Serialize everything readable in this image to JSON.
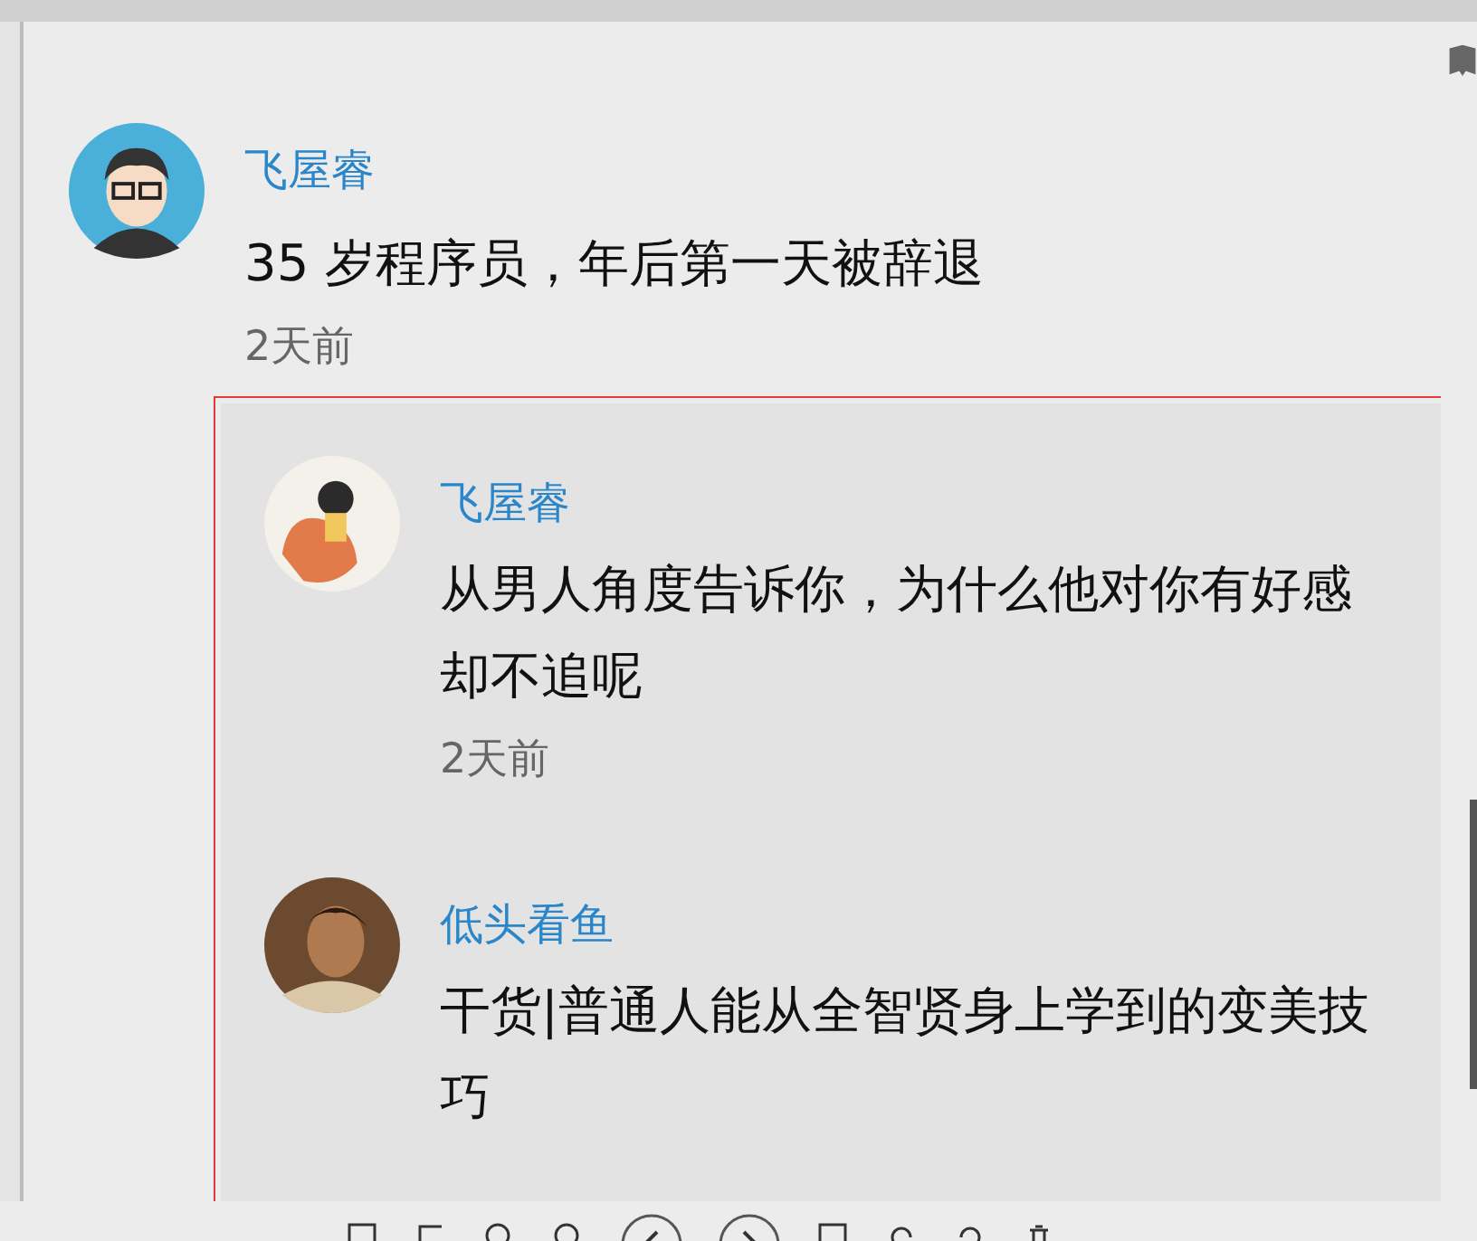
{
  "comment": {
    "author": "飞屋睿",
    "text": "35 岁程序员，年后第一天被辞退",
    "time": "2天前",
    "kind": "glasses"
  },
  "replies": [
    {
      "author": "飞屋睿",
      "text": "从男人角度告诉你，为什么他对你有好感却不追呢",
      "time": "2天前",
      "kind": "drawing"
    },
    {
      "author": "低头看鱼",
      "text": "干货|普通人能从全智贤身上学到的变美技巧",
      "kind": "photo"
    }
  ]
}
